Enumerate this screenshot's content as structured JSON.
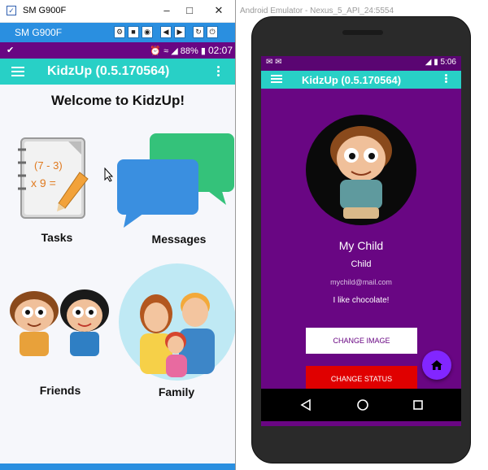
{
  "left_window": {
    "title": "SM G900F",
    "device_name": "SM G900F",
    "status": {
      "battery": "88%",
      "time": "02:07"
    },
    "app": {
      "title": "KidzUp (0.5.170564)",
      "welcome": "Welcome to KidzUp!",
      "tiles": [
        {
          "label": "Tasks",
          "icon": "task-notepad-icon"
        },
        {
          "label": "Messages",
          "icon": "chat-bubbles-icon"
        },
        {
          "label": "Friends",
          "icon": "friends-kids-icon"
        },
        {
          "label": "Family",
          "icon": "family-group-icon"
        }
      ]
    }
  },
  "right_window": {
    "title": "Android Emulator - Nexus_5_API_24:5554",
    "status": {
      "time": "5:06"
    },
    "app": {
      "title": "KidzUp (0.5.170564)",
      "profile_name": "My Child",
      "role": "Child",
      "email": "mychild@mail.com",
      "status_message": "I like chocolate!",
      "change_image_label": "CHANGE IMAGE",
      "change_status_label": "CHANGE STATUS"
    }
  },
  "colors": {
    "status_purple": "#690683",
    "app_bar_teal": "#28d0c6",
    "fab_purple": "#8226ff",
    "change_status_red": "#e00000",
    "control_bar_blue": "#2a8fe0"
  }
}
